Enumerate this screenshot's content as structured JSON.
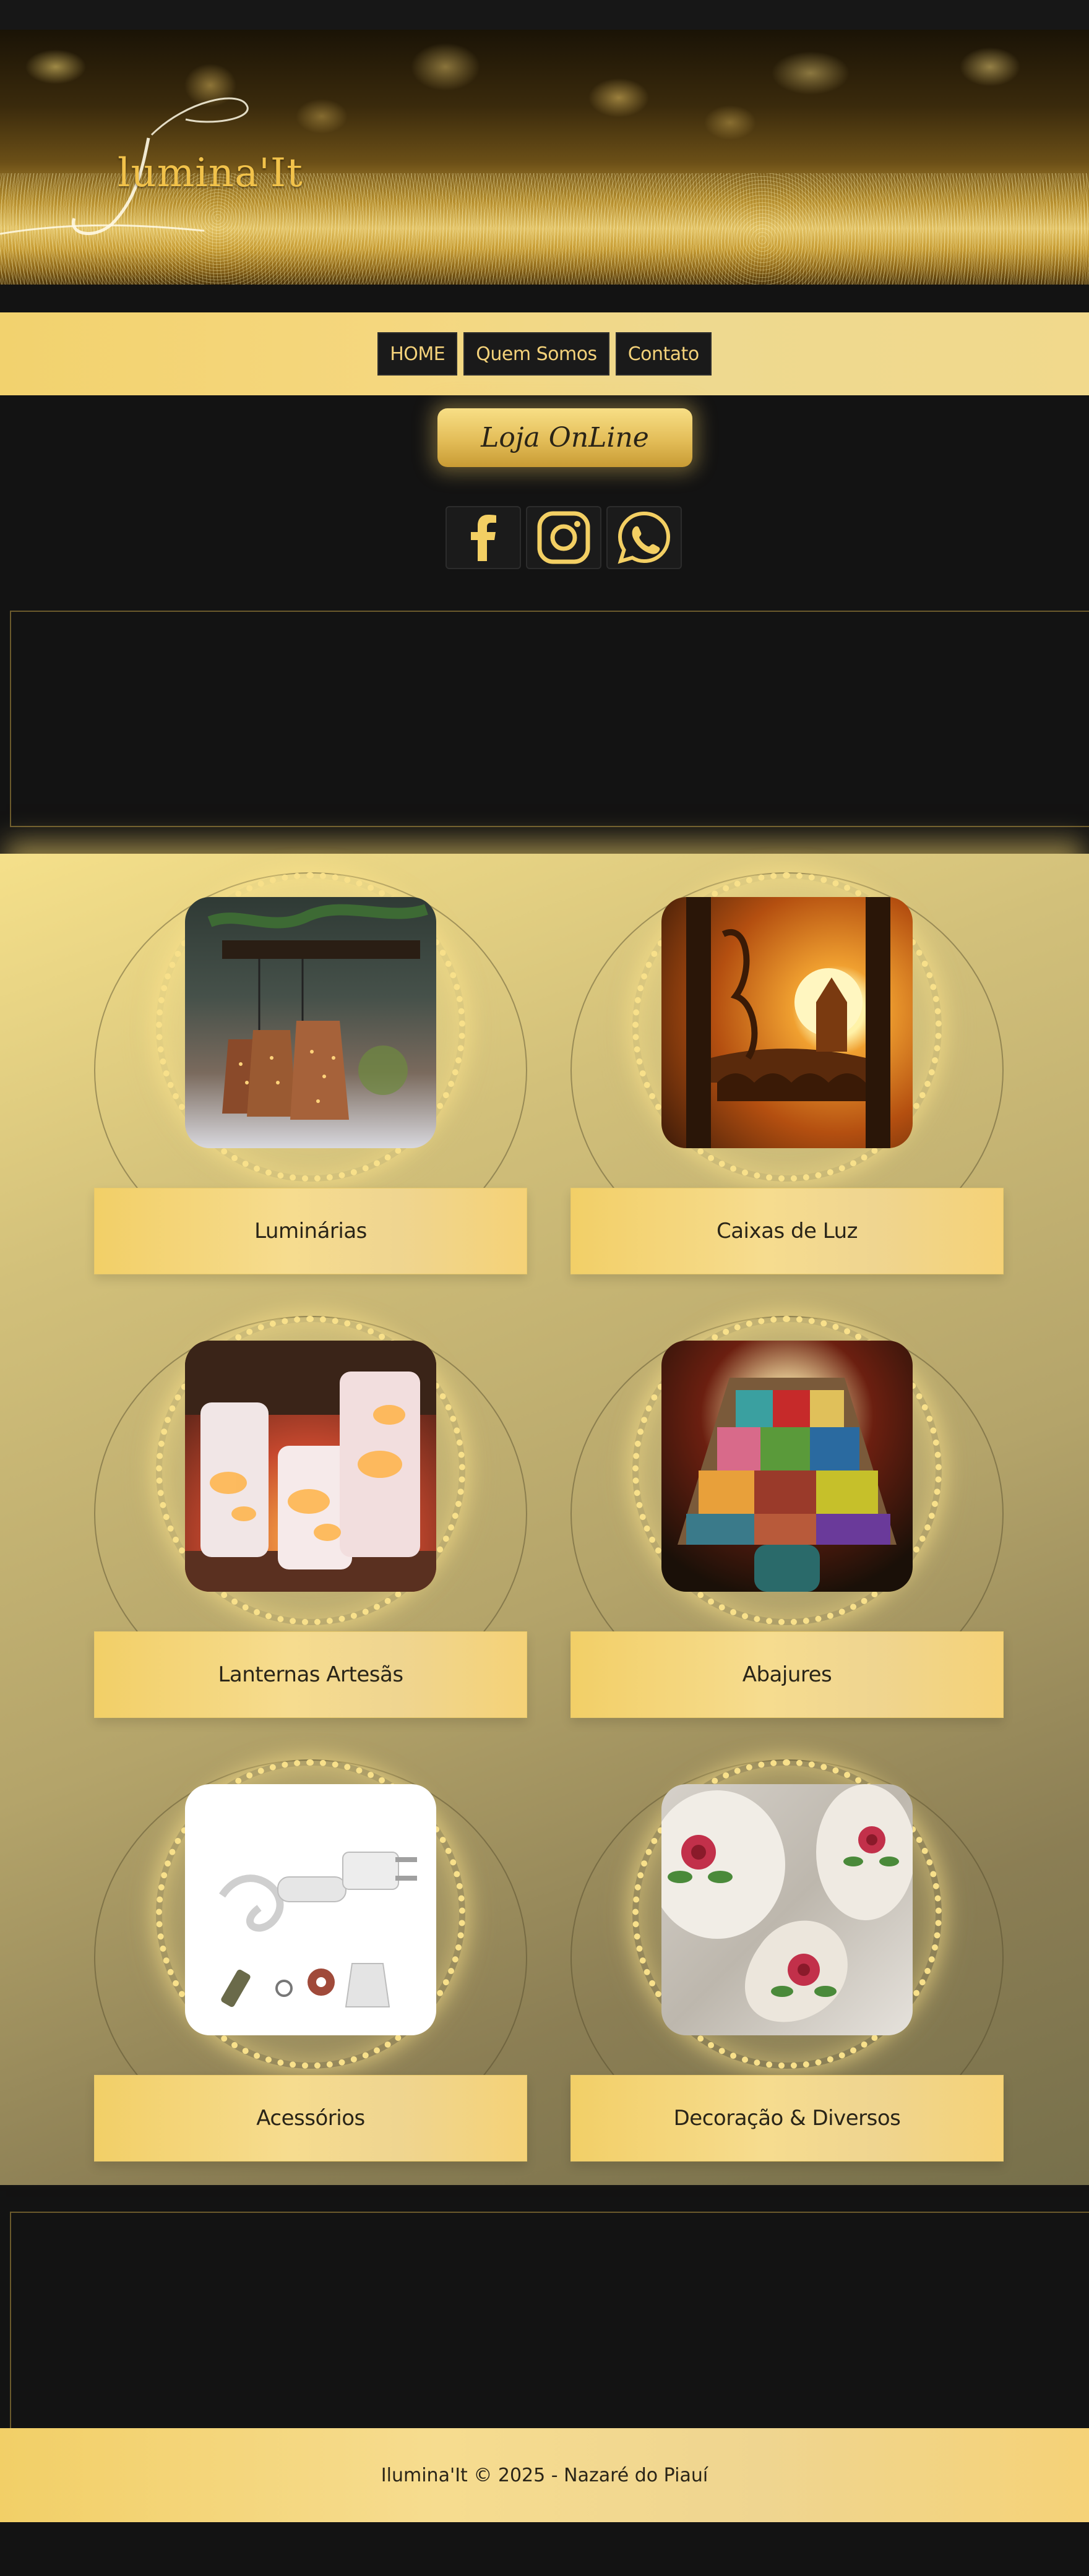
{
  "header": {
    "brand_initial": "I",
    "brand_name": "lumina'It"
  },
  "nav": {
    "items": [
      {
        "label": "HOME"
      },
      {
        "label": "Quem Somos"
      },
      {
        "label": "Contato"
      }
    ]
  },
  "shop_button": {
    "label": "Loja OnLine"
  },
  "social": {
    "icons": [
      "facebook-icon",
      "instagram-icon",
      "whatsapp-icon"
    ]
  },
  "products": {
    "items": [
      {
        "label": "Luminárias"
      },
      {
        "label": "Caixas de Luz"
      },
      {
        "label": "Lanternas Artesãs"
      },
      {
        "label": "Abajures"
      },
      {
        "label": "Acessórios"
      },
      {
        "label": "Decoração & Diversos"
      }
    ]
  },
  "footer": {
    "text": "Ilumina'It © 2025 - Nazaré do Piauí"
  },
  "colors": {
    "gold": "#f2cf67",
    "dark": "#131313",
    "nav_text": "#f4d27a"
  }
}
